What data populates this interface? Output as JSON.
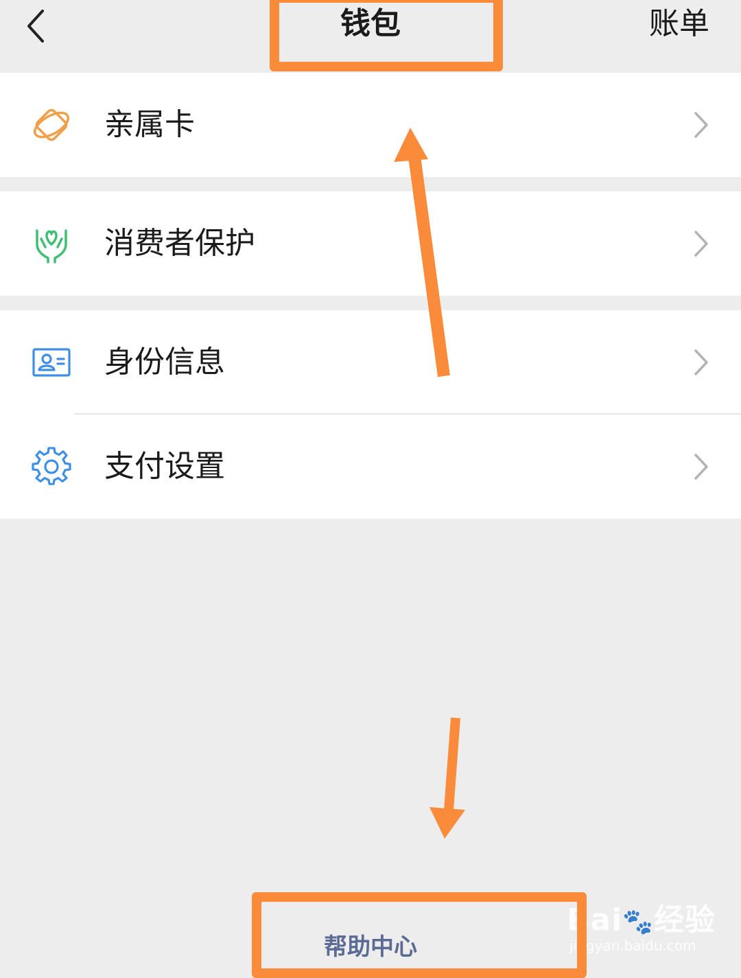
{
  "header": {
    "back_icon": "chevron-left-icon",
    "title": "钱包",
    "right_link": "账单"
  },
  "menu": [
    {
      "label": "亲属卡",
      "icon": "family-card-icon",
      "color": "#f1a04a"
    },
    {
      "label": "消费者保护",
      "icon": "hands-protection-icon",
      "color": "#3fbf73"
    },
    {
      "label": "身份信息",
      "icon": "id-card-icon",
      "color": "#3d8ee6"
    },
    {
      "label": "支付设置",
      "icon": "gear-icon",
      "color": "#3d8ee6"
    }
  ],
  "footer": {
    "help_label": "帮助中心"
  },
  "watermark": {
    "brand_a": "Bai",
    "brand_b": "经验",
    "url": "jingyan.baidu.com"
  },
  "annotation_color": "#f98b3a"
}
